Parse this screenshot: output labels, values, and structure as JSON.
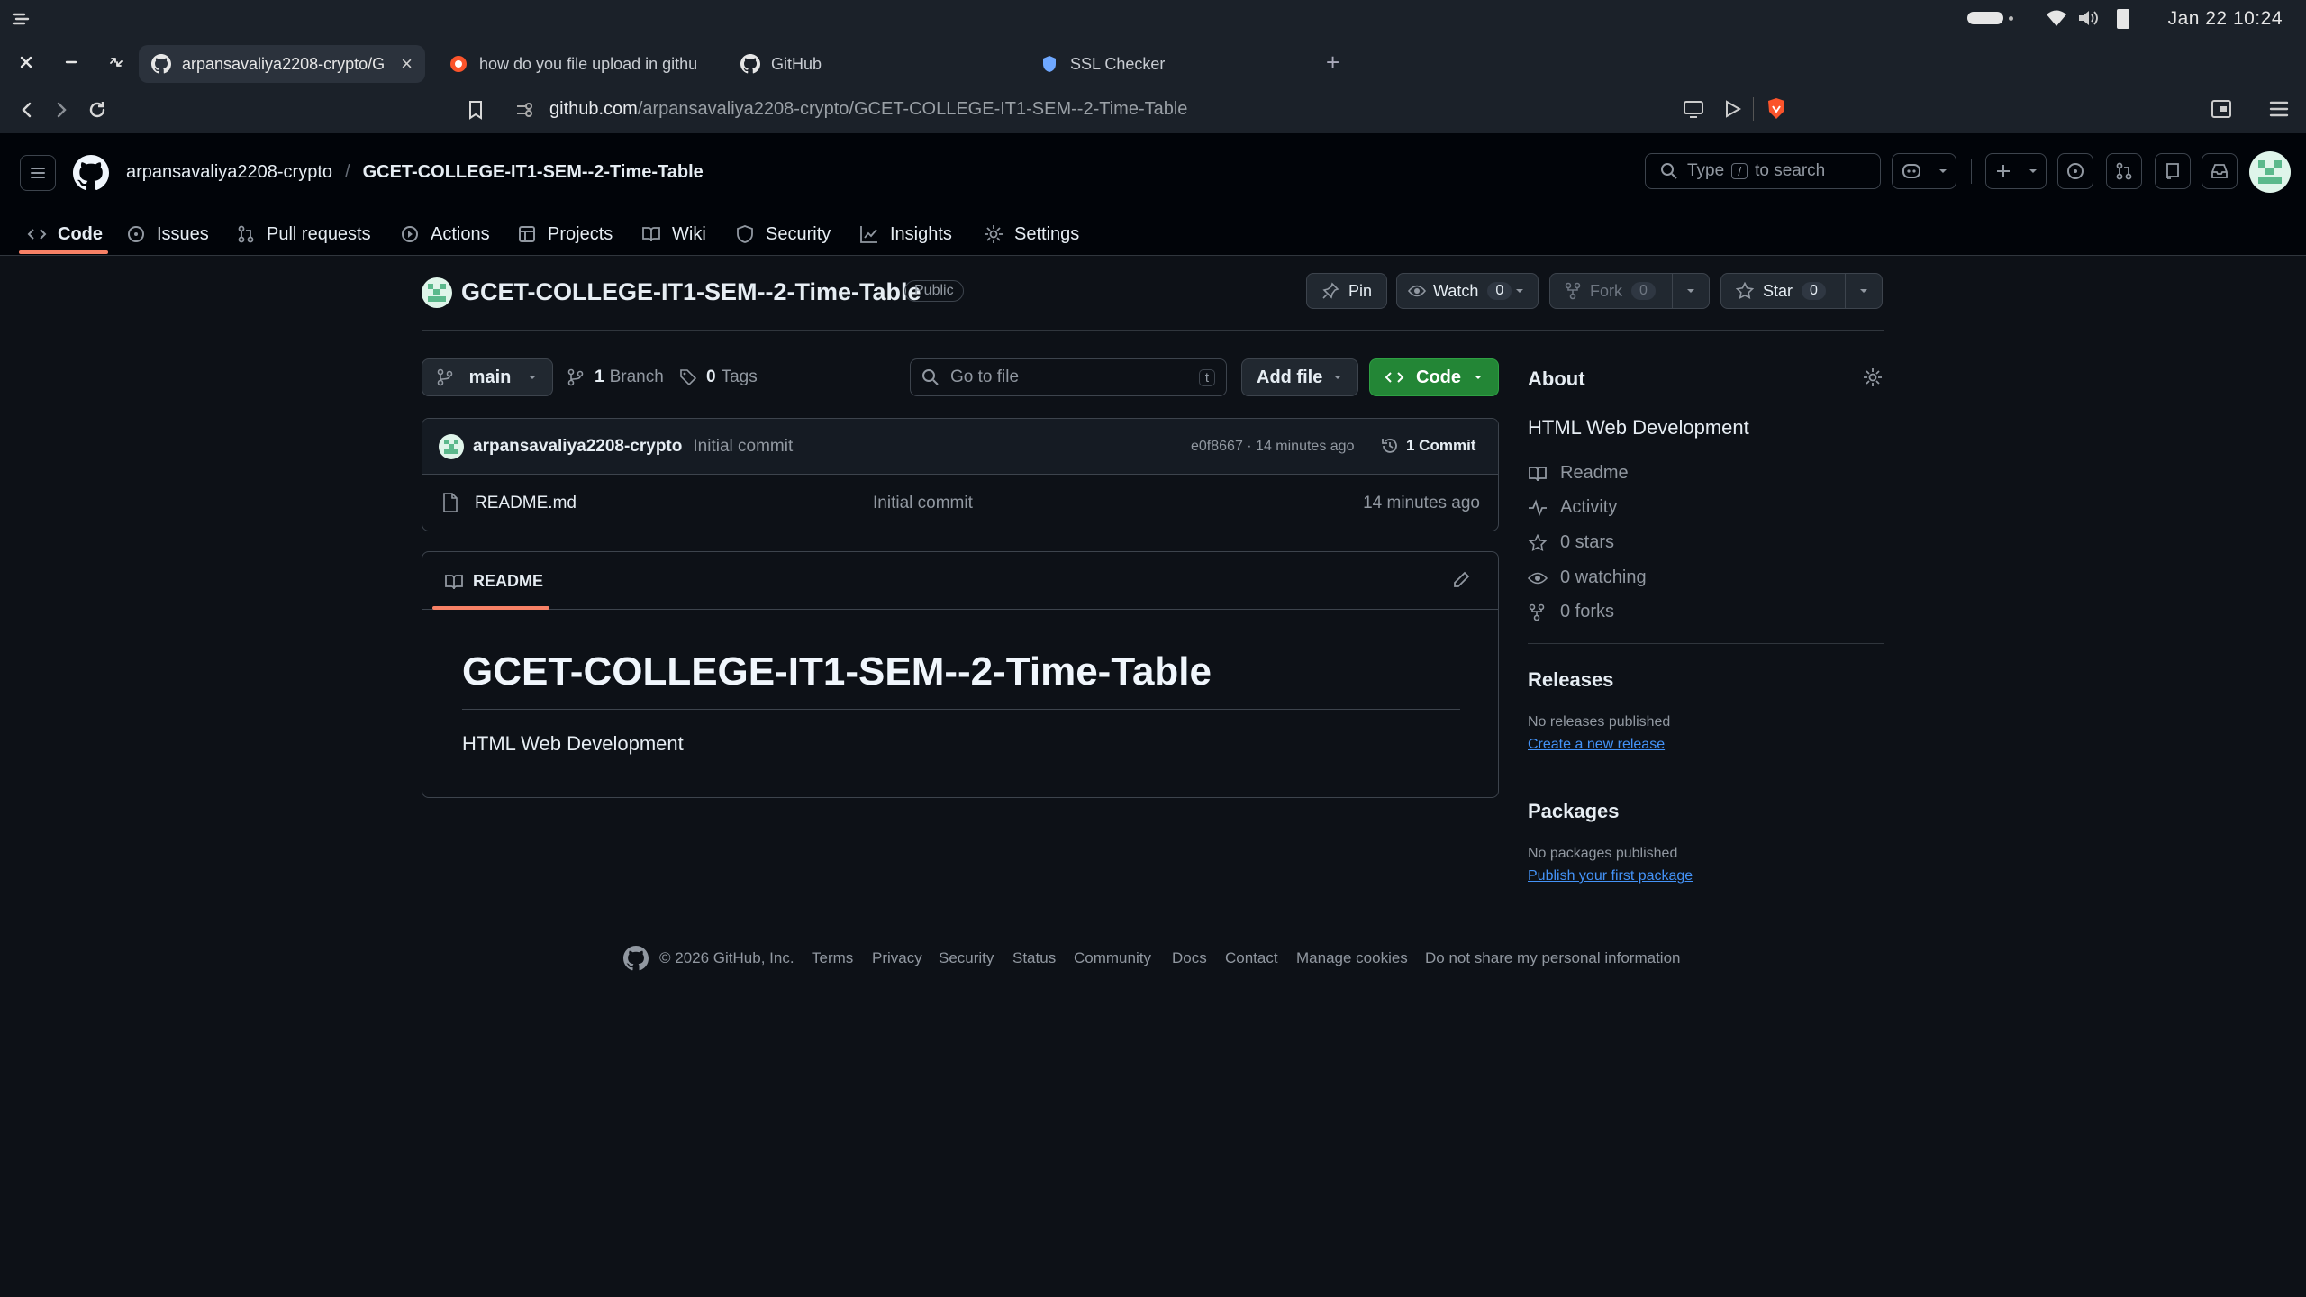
{
  "os": {
    "clock": "Jan 22  10:24"
  },
  "tabs": [
    {
      "label": "arpansavaliya2208-crypto/G",
      "icon": "github-icon",
      "active": true
    },
    {
      "label": "how do you file upload in githu",
      "icon": "brave-search-icon"
    },
    {
      "label": "GitHub",
      "icon": "github-icon"
    },
    {
      "label": "SSL Checker",
      "icon": "shield-icon"
    }
  ],
  "address": {
    "host": "github.com",
    "path": "/arpansavaliya2208-crypto/GCET-COLLEGE-IT1-SEM--2-Time-Table"
  },
  "header": {
    "owner": "arpansavaliya2208-crypto",
    "slash": "/",
    "repo": "GCET-COLLEGE-IT1-SEM--2-Time-Table",
    "search_placeholder_pre": "Type",
    "search_key": "/",
    "search_placeholder_post": "to search"
  },
  "repo_nav": [
    {
      "label": "Code",
      "icon": "code-icon",
      "active": true
    },
    {
      "label": "Issues",
      "icon": "issue-icon"
    },
    {
      "label": "Pull requests",
      "icon": "pull-request-icon"
    },
    {
      "label": "Actions",
      "icon": "play-icon"
    },
    {
      "label": "Projects",
      "icon": "table-icon"
    },
    {
      "label": "Wiki",
      "icon": "book-icon"
    },
    {
      "label": "Security",
      "icon": "shield-icon"
    },
    {
      "label": "Insights",
      "icon": "graph-icon"
    },
    {
      "label": "Settings",
      "icon": "gear-icon"
    }
  ],
  "repo": {
    "title": "GCET-COLLEGE-IT1-SEM--2-Time-Table",
    "visibility": "Public",
    "pin": "Pin",
    "watch": "Watch",
    "watch_count": "0",
    "fork": "Fork",
    "fork_count": "0",
    "star": "Star",
    "star_count": "0"
  },
  "toolbar": {
    "branch": "main",
    "branches_count": "1",
    "branches_label": "Branch",
    "tags_count": "0",
    "tags_label": "Tags",
    "goto_placeholder": "Go to file",
    "goto_key": "t",
    "add_file": "Add file",
    "code": "Code"
  },
  "commit": {
    "author": "arpansavaliya2208-crypto",
    "message": "Initial commit",
    "hash_time": "e0f8667 · 14 minutes ago",
    "count_label": "1 Commit"
  },
  "files": [
    {
      "name": "README.md",
      "message": "Initial commit",
      "time": "14 minutes ago"
    }
  ],
  "readme": {
    "tab": "README",
    "heading": "GCET-COLLEGE-IT1-SEM--2-Time-Table",
    "body": "HTML Web Development"
  },
  "about": {
    "title": "About",
    "description": "HTML Web Development",
    "items": [
      {
        "label": "Readme",
        "icon": "book-icon"
      },
      {
        "label": "Activity",
        "icon": "pulse-icon"
      },
      {
        "label": "0 stars",
        "icon": "star-icon"
      },
      {
        "label": "0 watching",
        "icon": "eye-icon"
      },
      {
        "label": "0 forks",
        "icon": "fork-icon"
      }
    ]
  },
  "releases": {
    "title": "Releases",
    "empty": "No releases published",
    "link": "Create a new release"
  },
  "packages": {
    "title": "Packages",
    "empty": "No packages published",
    "link": "Publish your first package"
  },
  "footer": {
    "copyright": "© 2026 GitHub, Inc.",
    "links": [
      "Terms",
      "Privacy",
      "Security",
      "Status",
      "Community",
      "Docs",
      "Contact",
      "Manage cookies",
      "Do not share my personal information"
    ]
  },
  "colors": {
    "accent_green": "#238636",
    "link_blue": "#4493f8",
    "underline_orange": "#f78166"
  }
}
